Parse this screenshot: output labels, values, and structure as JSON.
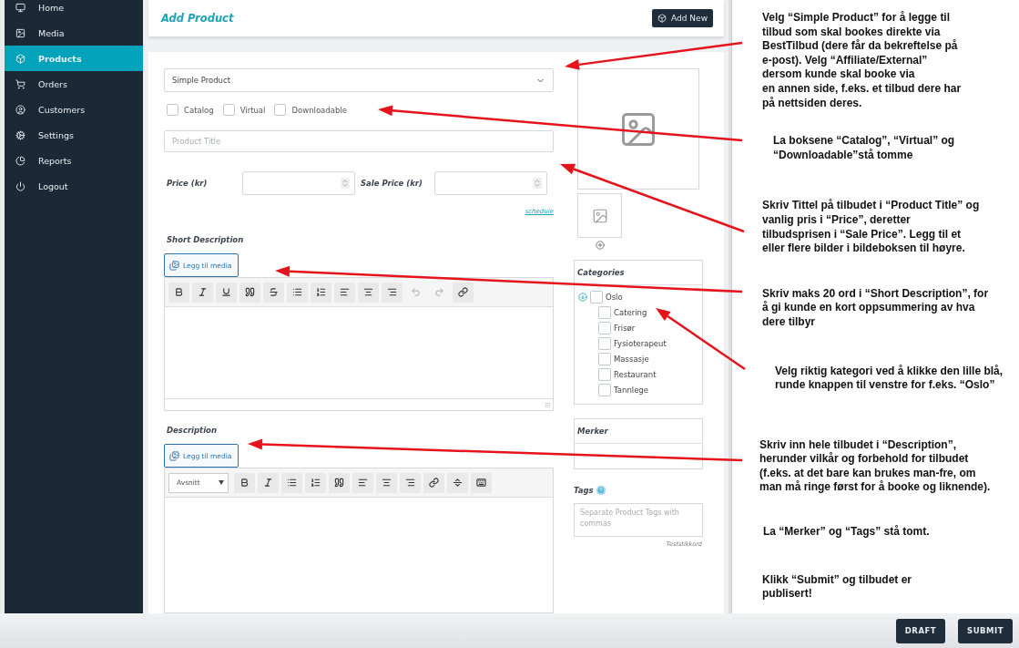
{
  "sidebar": {
    "items": [
      {
        "label": "Home",
        "selected": false
      },
      {
        "label": "Media",
        "selected": false
      },
      {
        "label": "Products",
        "selected": true
      },
      {
        "label": "Orders",
        "selected": false
      },
      {
        "label": "Customers",
        "selected": false
      },
      {
        "label": "Settings",
        "selected": false
      },
      {
        "label": "Reports",
        "selected": false
      },
      {
        "label": "Logout",
        "selected": false
      }
    ]
  },
  "header": {
    "title": "Add Product",
    "add_button": "Add New"
  },
  "product_form": {
    "product_type": "Simple Product",
    "options": [
      {
        "label": "Catalog",
        "checked": false
      },
      {
        "label": "Virtual",
        "checked": false
      },
      {
        "label": "Downloadable",
        "checked": false
      }
    ],
    "title_field": {
      "placeholder": "Product Title"
    },
    "price": {
      "label": "Price (kr)"
    },
    "sale_price": {
      "label": "Sale Price (kr)"
    },
    "schedule_link": "schedule",
    "short_description": {
      "label": "Short Description",
      "media_button": "Legg til media",
      "toolbar": [
        {
          "kind": "bold",
          "disabled": false
        },
        {
          "kind": "italic",
          "disabled": false
        },
        {
          "kind": "underline",
          "disabled": false
        },
        {
          "kind": "quote",
          "disabled": false
        },
        {
          "kind": "strike",
          "disabled": false
        },
        {
          "kind": "bullets",
          "disabled": false
        },
        {
          "kind": "numbers",
          "disabled": false
        },
        {
          "kind": "left",
          "disabled": false
        },
        {
          "kind": "center",
          "disabled": false
        },
        {
          "kind": "right",
          "disabled": false
        },
        {
          "kind": "undo",
          "disabled": true
        },
        {
          "kind": "redo",
          "disabled": true
        },
        {
          "kind": "link",
          "disabled": false
        }
      ]
    },
    "description": {
      "label": "Description",
      "media_button": "Legg til media",
      "format_select": "Avsnitt",
      "toolbar": [
        {
          "kind": "bold",
          "disabled": false
        },
        {
          "kind": "italic",
          "disabled": false
        },
        {
          "kind": "bullets",
          "disabled": false
        },
        {
          "kind": "numbers",
          "disabled": false
        },
        {
          "kind": "quote",
          "disabled": false
        },
        {
          "kind": "left",
          "disabled": false
        },
        {
          "kind": "center",
          "disabled": false
        },
        {
          "kind": "right",
          "disabled": false
        },
        {
          "kind": "link",
          "disabled": false
        },
        {
          "kind": "more",
          "disabled": false
        },
        {
          "kind": "kitchen",
          "disabled": false
        }
      ]
    },
    "categories": {
      "title": "Categories",
      "items": [
        {
          "label": "Oslo",
          "checked": false,
          "expanded": true,
          "children": [
            {
              "label": "Catering",
              "checked": false
            },
            {
              "label": "Frisør",
              "checked": false
            },
            {
              "label": "Fysioterapeut",
              "checked": false
            },
            {
              "label": "Massasje",
              "checked": false
            },
            {
              "label": "Restaurant",
              "checked": false
            },
            {
              "label": "Tannlege",
              "checked": false
            }
          ]
        }
      ]
    },
    "merker": {
      "title": "Merker"
    },
    "tags": {
      "label": "Tags",
      "placeholder": "Separate Product Tags with commas",
      "hint": "Teststikkord"
    }
  },
  "instructions": [
    {
      "lines": [
        "Velg “Simple Product” for å legge til",
        "tilbud som skal bookes direkte via",
        "BestTilbud (dere får da bekreftelse på",
        "e-post). Velg “Affiliate/External”",
        "dersom kunde skal booke via",
        "en annen side, f.eks. et tilbud dere har",
        "på nettsiden deres."
      ]
    },
    {
      "lines": [
        "La boksene “Catalog”, “Virtual” og",
        "“Downloadable”stå tomme"
      ]
    },
    {
      "lines": [
        "Skriv Tittel på tilbudet i “Product Title” og",
        "vanlig pris i “Price”, deretter",
        "tilbudsprisen i “Sale Price”. Legg til et",
        "eller flere bilder i bildeboksen til høyre."
      ]
    },
    {
      "lines": [
        "Skriv maks 20 ord i “Short Description”, for",
        "å gi kunde en kort oppsummering av hva",
        "dere tilbyr"
      ]
    },
    {
      "lines": [
        "Velg riktig kategori ved å klikke den lille blå,",
        "runde knappen til venstre for f.eks. “Oslo”"
      ]
    },
    {
      "lines": [
        "Skriv inn hele tilbudet i “Description”,",
        "herunder vilkår og forbehold for tilbudet",
        "(f.eks. at det bare kan brukes man-fre, om",
        "man må ringe først for å booke og liknende)."
      ]
    },
    {
      "lines": [
        "La “Merker” og “Tags” stå tomt."
      ]
    },
    {
      "lines": [
        "Klikk “Submit” og tilbudet er",
        "publisert!"
      ]
    }
  ],
  "actions": [
    "DRAFT",
    "SUBMIT"
  ]
}
